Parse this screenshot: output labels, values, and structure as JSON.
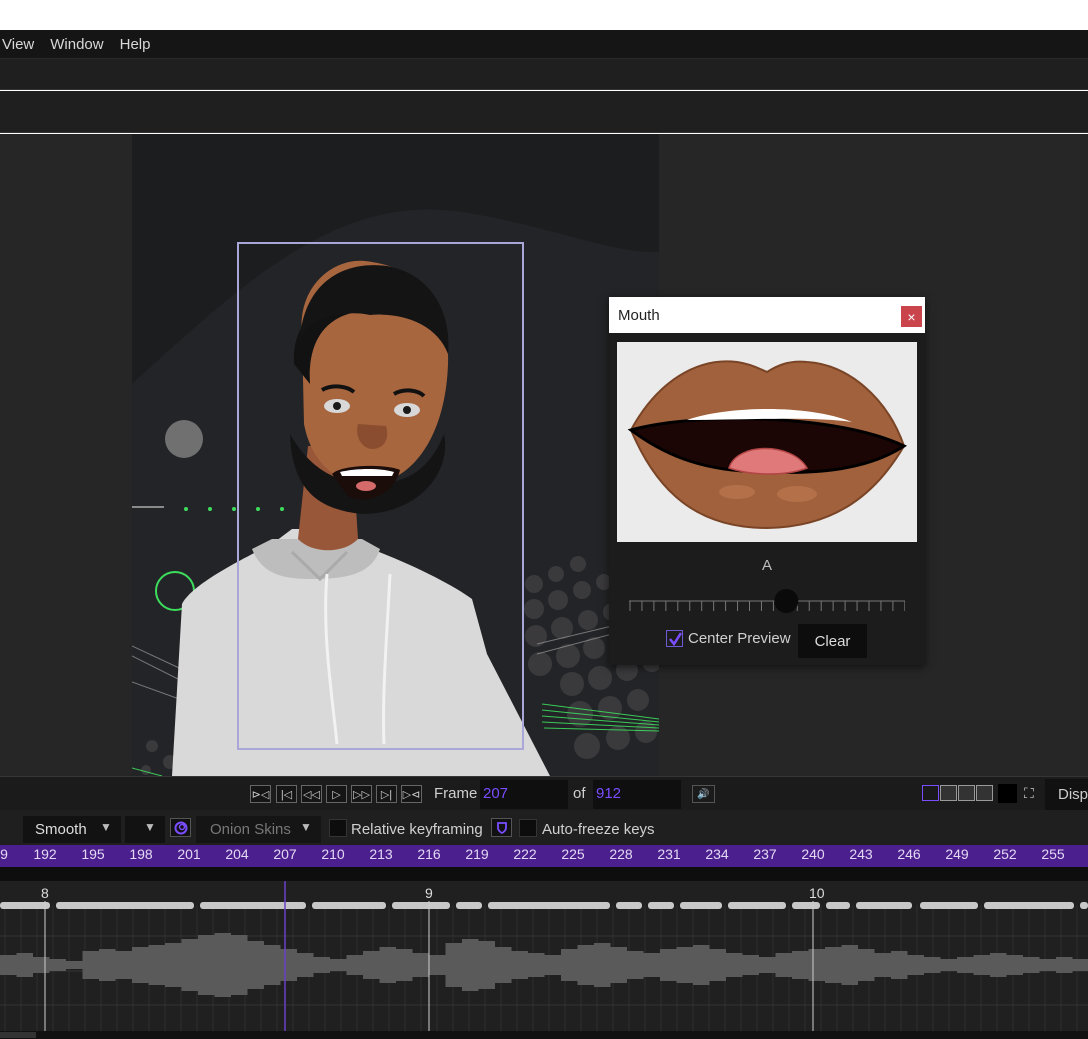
{
  "menu": [
    "View",
    "Window",
    "Help"
  ],
  "mouth_panel": {
    "title": "Mouth",
    "close": "×",
    "viseme": "A",
    "slider_position": 0.57,
    "center_preview_label": "Center Preview",
    "center_preview_checked": true,
    "clear_label": "Clear"
  },
  "transport": {
    "buttons": [
      "⊳◁",
      "|◁",
      "◁◁",
      "▷",
      "▷▷",
      "▷|",
      "▷⊲"
    ],
    "frame_label": "Frame",
    "frame_value": "207",
    "of_label": "of",
    "total_frames": "912",
    "volume": "🔊",
    "display_label": "Disp"
  },
  "options": {
    "interpolation": "Smooth",
    "onion_skins": "Onion Skins",
    "relative_keyframing": "Relative keyframing",
    "auto_freeze": "Auto-freeze keys"
  },
  "ruler": {
    "labels": [
      "9",
      "192",
      "195",
      "198",
      "201",
      "204",
      "207",
      "210",
      "213",
      "216",
      "219",
      "222",
      "225",
      "228",
      "231",
      "234",
      "237",
      "240",
      "243",
      "246",
      "249",
      "252",
      "255"
    ],
    "current": "207"
  },
  "tracks": {
    "second_markers": [
      "8",
      "9",
      "10"
    ]
  },
  "colors": {
    "accent": "#7a4dff",
    "ruler_bg": "#4c1f8e",
    "close_bg": "#c9444b"
  }
}
